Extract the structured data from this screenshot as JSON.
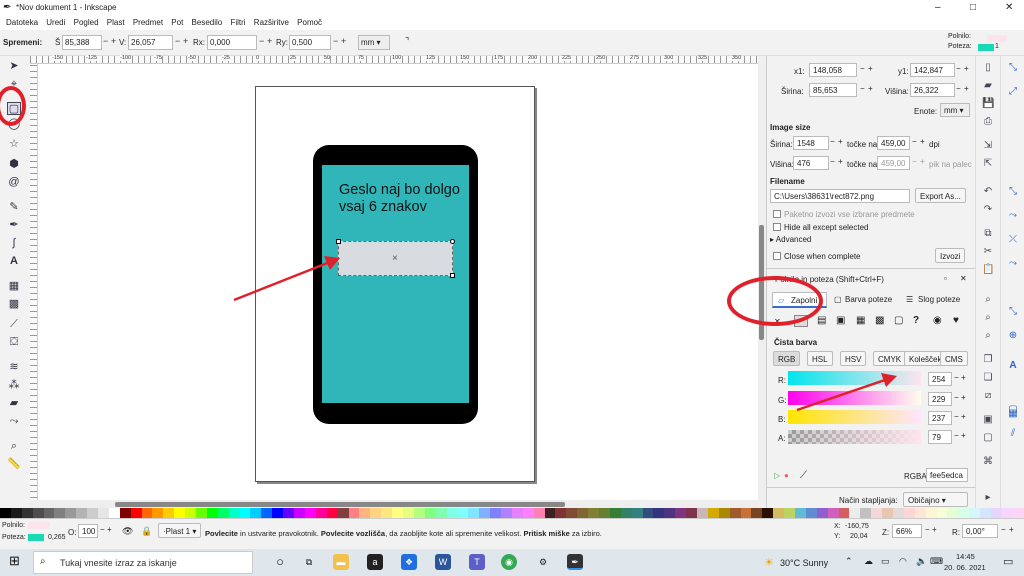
{
  "title_bar": {
    "title": "*Nov dokument 1 - Inkscape",
    "minimize": "–",
    "maximize": "□",
    "close": "✕"
  },
  "menu": [
    "Datoteka",
    "Uredi",
    "Pogled",
    "Plast",
    "Predmet",
    "Pot",
    "Besedilo",
    "Filtri",
    "Razširitve",
    "Pomoč"
  ],
  "toolbar": {
    "change_label": "Spremeni:",
    "s_label": "Š",
    "s_value": "85,388",
    "v_label": "V:",
    "v_value": "26,057",
    "rx_label": "Rx:",
    "rx_value": "0,000",
    "ry_label": "Ry:",
    "ry_value": "0,500",
    "unit": "mm ▾"
  },
  "fill_stroke_indicator": {
    "fill_label": "Polnilo:",
    "stroke_label": "Poteza:",
    "stroke_value": "1"
  },
  "canvas": {
    "phone_text": "Geslo naj bo dolgo vsaj 6 znakov",
    "box_center_mark": "×",
    "ruler_marks": [
      "-150",
      "-125",
      "-100",
      "-75",
      "-50",
      "-25",
      "0",
      "25",
      "50",
      "75",
      "100",
      "125",
      "150",
      "175",
      "200",
      "225",
      "250",
      "275",
      "300",
      "325",
      "350"
    ]
  },
  "export": {
    "x1_label": "x1:",
    "x1_value": "148,058",
    "y1_label": "y1:",
    "y1_value": "142,847",
    "sirina_label": "Širina:",
    "sirina_value": "85,653",
    "visina_label": "Višina:",
    "visina_value": "26,322",
    "enote_label": "Enote:",
    "enote_value": "mm ▾",
    "image_size": "Image size",
    "is_sirina_label": "Širina:",
    "is_sirina": "1548",
    "tocke_na": "točke na",
    "dpi_value": "459,00",
    "dpi": "dpi",
    "is_visina_label": "Višina:",
    "is_visina": "476",
    "dpi2_value": "459,00",
    "pik_na_palec": "pik na palec",
    "filename_label": "Filename",
    "filename": "C:\\Users\\38631\\rect872.png",
    "export_as": "Export As...",
    "batch": "Paketno izvozi vse izbrane predmete",
    "hide_all": "Hide all except selected",
    "advanced": "Advanced",
    "close_when_complete": "Close when complete",
    "izvozi": "Izvozi"
  },
  "fill_panel": {
    "header": "Polnilo in poteza  (Shift+Ctrl+F)",
    "tabs": [
      "Zapolni",
      "Barva poteze",
      "Slog poteze"
    ],
    "flat_color": "Čista barva",
    "models": [
      "RGB",
      "HSL",
      "HSV",
      "CMYK",
      "Kolešček",
      "CMS"
    ],
    "channels": [
      {
        "label": "R:",
        "value": "254"
      },
      {
        "label": "G:",
        "value": "229"
      },
      {
        "label": "B:",
        "value": "237"
      },
      {
        "label": "A:",
        "value": "79"
      }
    ],
    "rgba_label": "RGBA:",
    "rgba_value": "fee5edca",
    "blend_label": "Način stapljanja:",
    "blend_value": "Običajno"
  },
  "status": {
    "fill_label": "Polnilo:",
    "stroke_label": "Poteza:",
    "stroke_width": "0,265",
    "opacity_label": "O:",
    "opacity": "100",
    "layer": "·Plast 1 ▾",
    "msg_strong1": "Povlecite",
    "msg1": " in ustvarite pravokotnik. ",
    "msg_strong2": "Povlecite vozlišča",
    "msg2": ", da zaobljite kote ali spremenite velikost. ",
    "msg_strong3": "Pritisk miške",
    "msg3": " za izbiro.",
    "x_label": "X:",
    "x_value": "-160,75",
    "y_label": "Y:",
    "y_value": "20,04",
    "z_label": "Z:",
    "zoom": "66%",
    "r_label": "R:",
    "rotation": "0,00°"
  },
  "taskbar": {
    "search": "Tukaj vnesite izraz za iskanje",
    "weather": "30°C  Sunny",
    "time": "14:45",
    "date": "20. 06. 2021"
  },
  "colors": {
    "accent": "#e0202a",
    "teal": "#30b6b8"
  }
}
